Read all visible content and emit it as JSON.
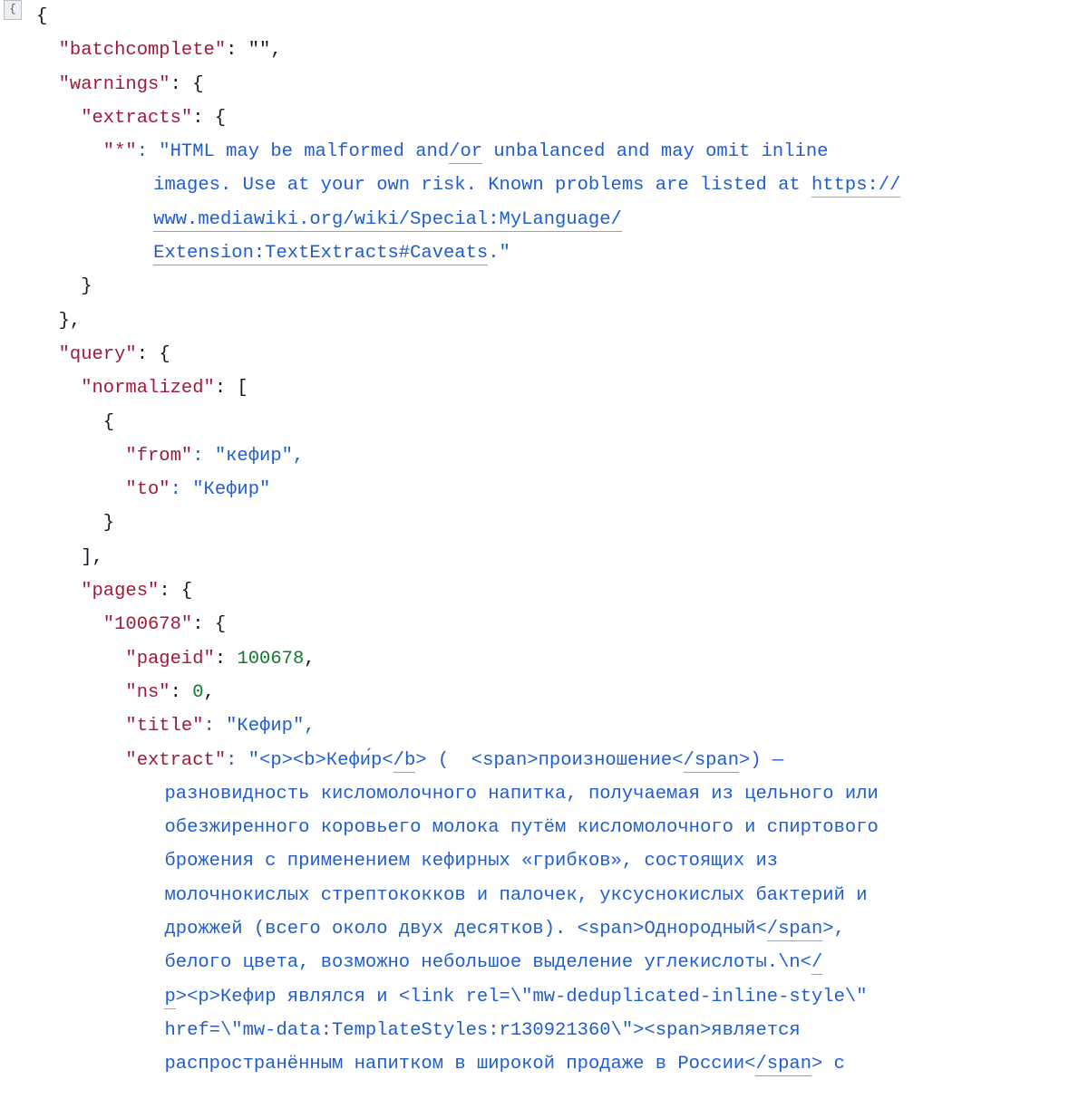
{
  "gutter_symbol": "{",
  "lines": {
    "l01": "{",
    "l02_key": "\"batchcomplete\"",
    "l02_rest": ": \"\",",
    "l03_key": "\"warnings\"",
    "l03_rest": ": {",
    "l04_key": "\"extracts\"",
    "l04_rest": ": {",
    "l05_key": "\"*\"",
    "l05_pre": ": \"HTML may be malformed and",
    "l05_u1": "/or",
    "l05_post": " unbalanced and may omit inline",
    "l06_a": "images. Use at your own risk. Known problems are listed at ",
    "l06_u": "https://",
    "l07_u": "www.mediawiki.org/wiki/Special:MyLanguage/",
    "l08_u": "Extension:TextExtracts#Caveats",
    "l08_post": ".\"",
    "l09": "}",
    "l10": "},",
    "l11_key": "\"query\"",
    "l11_rest": ": {",
    "l12_key": "\"normalized\"",
    "l12_rest": ": [",
    "l13": "{",
    "l14_key": "\"from\"",
    "l14_rest": ": \"кефир\",",
    "l15_key": "\"to\"",
    "l15_rest": ": \"Кефир\"",
    "l16": "}",
    "l17": "],",
    "l18_key": "\"pages\"",
    "l18_rest": ": {",
    "l19_key": "\"100678\"",
    "l19_rest": ": {",
    "l20_key": "\"pageid\"",
    "l20_colon": ": ",
    "l20_num": "100678",
    "l20_post": ",",
    "l21_key": "\"ns\"",
    "l21_colon": ": ",
    "l21_num": "0",
    "l21_post": ",",
    "l22_key": "\"title\"",
    "l22_rest": ": \"Кефир\",",
    "l23_key": "\"extract\"",
    "l23_a": ": \"<p><b>Кефи́р<",
    "l23_u": "/b",
    "l23_b": "> (  <span>произношение<",
    "l23_u2": "/span",
    "l23_c": ">) —",
    "l24": "разновидность кисломолочного напитка, получаемая из цельного или",
    "l25": "обезжиренного коровьего молока путём кисломолочного и спиртового",
    "l26": "брожения с применением кефирных «грибков», состоящих из",
    "l27": "молочнокислых стрептококков и палочек, уксуснокислых бактерий и",
    "l28_a": "дрожжей (всего около двух десятков). <span>Однородный<",
    "l28_u": "/span",
    "l28_b": ">,",
    "l29_a": "белого цвета, возможно небольшое выделение углекислоты.\\n<",
    "l29_u": "/",
    "l30_a": "p",
    "l30_b": "><p>Кефир являлся и <link rel=\\\"mw-deduplicated-inline-style\\\"",
    "l31": "href=\\\"mw-data:TemplateStyles:r130921360\\\"><span>является",
    "l32_a": "распространённым напитком в широкой продаже в России<",
    "l32_u": "/span",
    "l32_b": "> с"
  }
}
